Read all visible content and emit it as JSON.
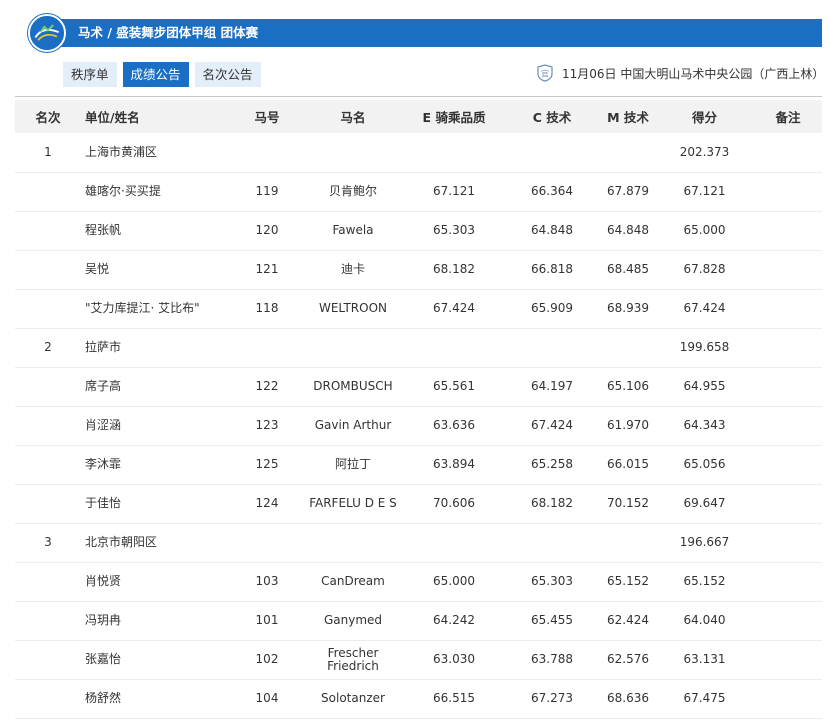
{
  "header": {
    "title": "马术 / 盛装舞步团体甲组  团体赛"
  },
  "tabs": [
    {
      "label": "秩序单",
      "active": false
    },
    {
      "label": "成绩公告",
      "active": true
    },
    {
      "label": "名次公告",
      "active": false
    }
  ],
  "venue": {
    "icon_label": "官",
    "text": "11月06日  中国大明山马术中央公园（广西上林）"
  },
  "colors": {
    "accent": "#1a6fc4",
    "tab_inactive_bg": "#e3eef9",
    "header_row_bg": "#f2f2f2"
  },
  "table": {
    "columns": [
      "名次",
      "单位/姓名",
      "马号",
      "马名",
      "E 骑乘品质",
      "C 技术",
      "M 技术",
      "得分",
      "备注"
    ],
    "groups": [
      {
        "rank": "1",
        "team": "上海市黄浦区",
        "score": "202.373",
        "riders": [
          {
            "name": "雄喀尔·买买提",
            "horse_no": "119",
            "horse": "贝肯鲍尔",
            "e": "67.121",
            "c": "66.364",
            "m": "67.879",
            "score": "67.121"
          },
          {
            "name": "程张帆",
            "horse_no": "120",
            "horse": "Fawela",
            "e": "65.303",
            "c": "64.848",
            "m": "64.848",
            "score": "65.000"
          },
          {
            "name": "吴悦",
            "horse_no": "121",
            "horse": "迪卡",
            "e": "68.182",
            "c": "66.818",
            "m": "68.485",
            "score": "67.828"
          },
          {
            "name": "\"艾力库提江· 艾比布\"",
            "horse_no": "118",
            "horse": "WELTROON",
            "e": "67.424",
            "c": "65.909",
            "m": "68.939",
            "score": "67.424"
          }
        ]
      },
      {
        "rank": "2",
        "team": "拉萨市",
        "score": "199.658",
        "riders": [
          {
            "name": "席子高",
            "horse_no": "122",
            "horse": "DROMBUSCH",
            "e": "65.561",
            "c": "64.197",
            "m": "65.106",
            "score": "64.955"
          },
          {
            "name": "肖涩涵",
            "horse_no": "123",
            "horse": "Gavin Arthur",
            "e": "63.636",
            "c": "67.424",
            "m": "61.970",
            "score": "64.343"
          },
          {
            "name": "李沐霏",
            "horse_no": "125",
            "horse": "阿拉丁",
            "e": "63.894",
            "c": "65.258",
            "m": "66.015",
            "score": "65.056"
          },
          {
            "name": "于佳怡",
            "horse_no": "124",
            "horse": "FARFELU D E S",
            "e": "70.606",
            "c": "68.182",
            "m": "70.152",
            "score": "69.647"
          }
        ]
      },
      {
        "rank": "3",
        "team": "北京市朝阳区",
        "score": "196.667",
        "riders": [
          {
            "name": "肖悦贤",
            "horse_no": "103",
            "horse": "CanDream",
            "e": "65.000",
            "c": "65.303",
            "m": "65.152",
            "score": "65.152"
          },
          {
            "name": "冯玥冉",
            "horse_no": "101",
            "horse": "Ganymed",
            "e": "64.242",
            "c": "65.455",
            "m": "62.424",
            "score": "64.040"
          },
          {
            "name": "张嘉怡",
            "horse_no": "102",
            "horse": "Frescher Friedrich",
            "e": "63.030",
            "c": "63.788",
            "m": "62.576",
            "score": "63.131"
          },
          {
            "name": "杨舒然",
            "horse_no": "104",
            "horse": "Solotanzer",
            "e": "66.515",
            "c": "67.273",
            "m": "68.636",
            "score": "67.475"
          }
        ]
      }
    ]
  }
}
